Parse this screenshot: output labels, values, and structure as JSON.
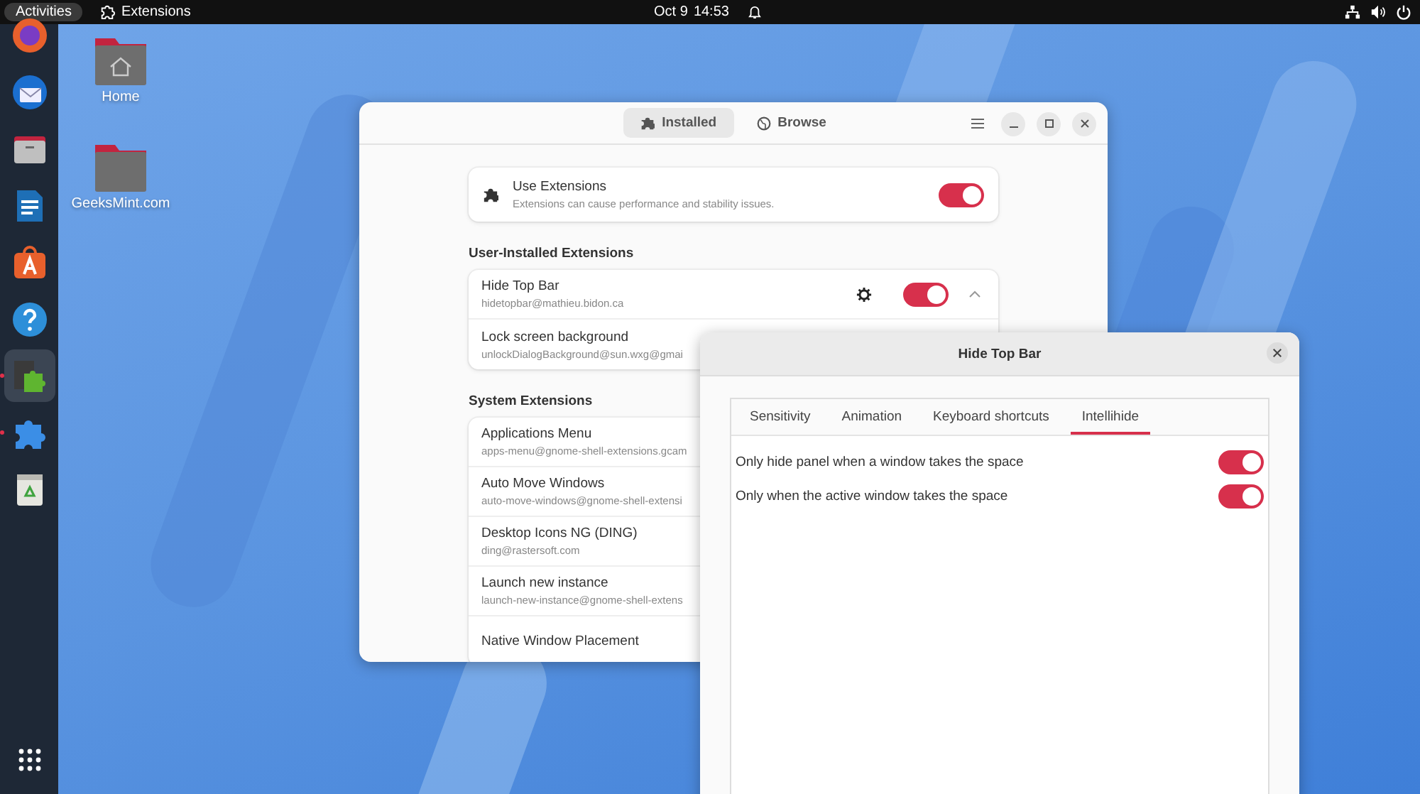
{
  "top_bar": {
    "activities": "Activities",
    "app_name": "Extensions",
    "date": "Oct 9",
    "time": "14:53"
  },
  "dock": {
    "items": [
      {
        "kind": "browser",
        "selected": false
      },
      {
        "kind": "mail",
        "selected": false
      },
      {
        "kind": "files",
        "selected": false
      },
      {
        "kind": "writer",
        "selected": false
      },
      {
        "kind": "store",
        "selected": false
      },
      {
        "kind": "help",
        "selected": false
      },
      {
        "kind": "extensions",
        "selected": true,
        "running": true
      },
      {
        "kind": "puzzle",
        "selected": false,
        "running": true
      },
      {
        "kind": "trash",
        "selected": false
      }
    ]
  },
  "desktop_icons": [
    {
      "label": "Home",
      "kind": "home"
    },
    {
      "label": "GeeksMint.com",
      "kind": "folder"
    }
  ],
  "extensions_window": {
    "tabs": [
      {
        "label": "Installed",
        "selected": true
      },
      {
        "label": "Browse",
        "selected": false
      }
    ],
    "master": {
      "title": "Use Extensions",
      "subtitle": "Extensions can cause performance and stability issues.",
      "on": true
    },
    "user_section": {
      "heading": "User-Installed Extensions",
      "items": [
        {
          "name": "Hide Top Bar",
          "uuid": "hidetopbar@mathieu.bidon.ca",
          "on": true,
          "has_settings": true,
          "expanded": true
        },
        {
          "name": "Lock screen background",
          "uuid": "unlockDialogBackground@sun.wxg@gmai"
        }
      ]
    },
    "system_section": {
      "heading": "System Extensions",
      "items": [
        {
          "name": "Applications Menu",
          "uuid": "apps-menu@gnome-shell-extensions.gcam"
        },
        {
          "name": "Auto Move Windows",
          "uuid": "auto-move-windows@gnome-shell-extensi"
        },
        {
          "name": "Desktop Icons NG (DING)",
          "uuid": "ding@rastersoft.com"
        },
        {
          "name": "Launch new instance",
          "uuid": "launch-new-instance@gnome-shell-extens"
        },
        {
          "name": "Native Window Placement"
        }
      ]
    }
  },
  "dialog": {
    "title": "Hide Top Bar",
    "tabs": [
      {
        "label": "Sensitivity",
        "selected": false
      },
      {
        "label": "Animation",
        "selected": false
      },
      {
        "label": "Keyboard shortcuts",
        "selected": false
      },
      {
        "label": "Intellihide",
        "selected": true
      }
    ],
    "settings": [
      {
        "label": "Only hide panel when a window takes the space",
        "on": true
      },
      {
        "label": "Only when the active window takes the space",
        "on": true
      }
    ]
  }
}
